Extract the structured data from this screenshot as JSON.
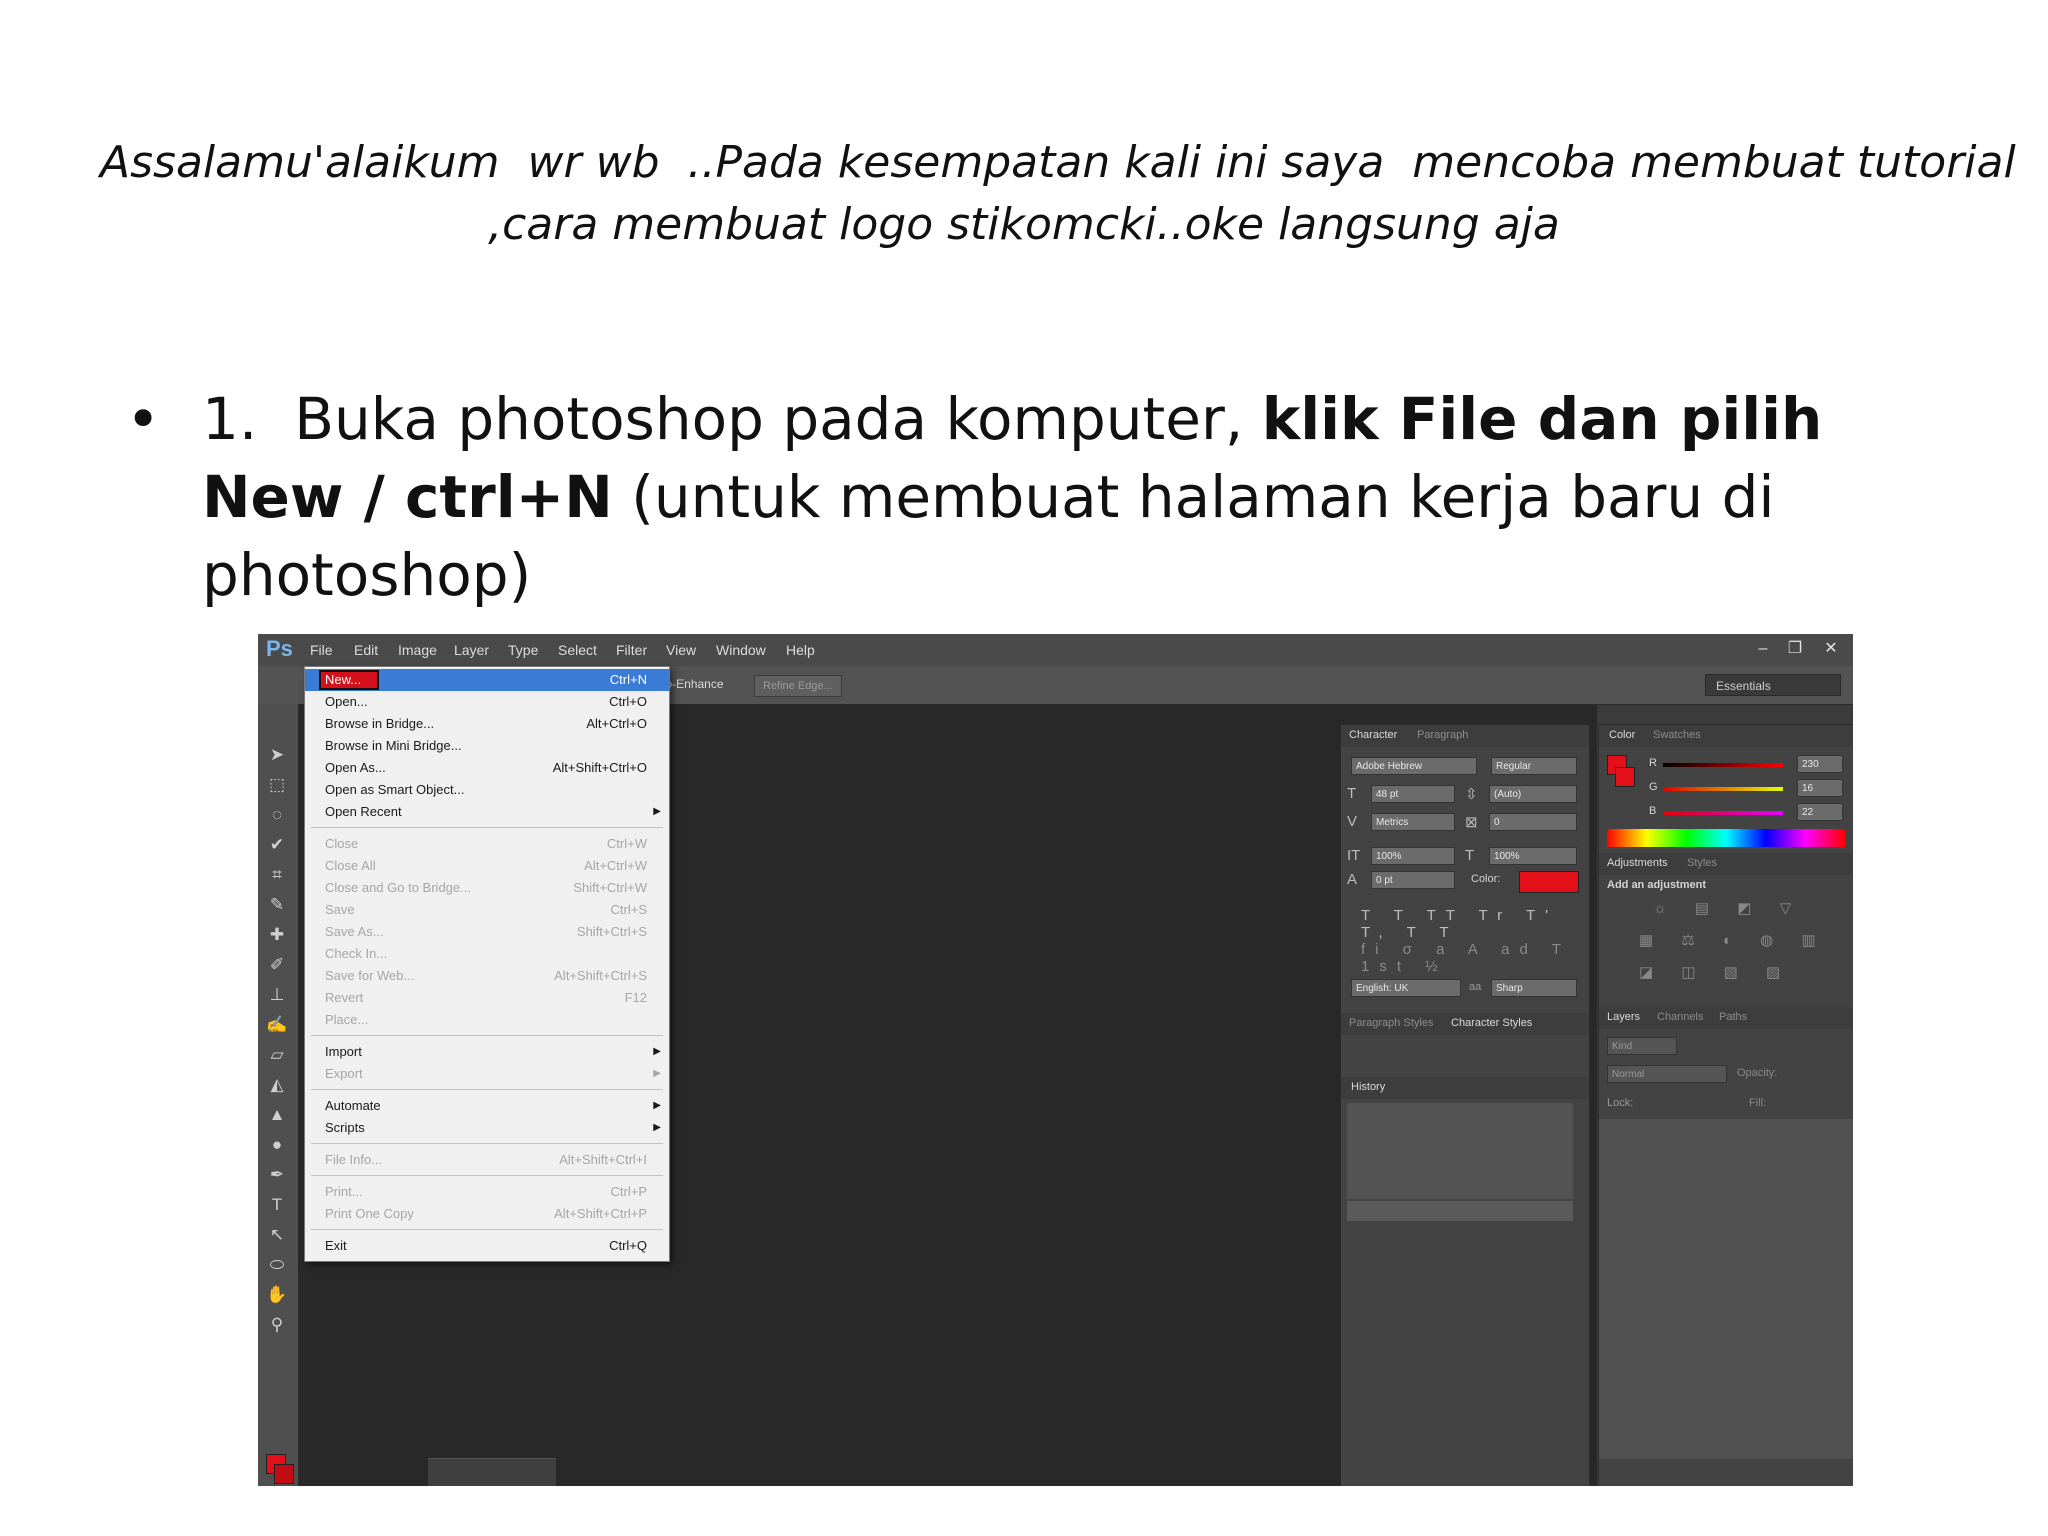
{
  "intro": {
    "line1": "Assalamu'alaikum  wr wb  ..Pada kesempatan kali ini saya  mencoba membuat tutorial",
    "line2": ",cara membuat logo stikomcki..oke langsung aja"
  },
  "step1": {
    "bullet": "•",
    "number": "1.",
    "text_plain_1": "Buka photoshop pada komputer, ",
    "text_bold_1": "klik File dan pilih New / ctrl+N",
    "text_plain_2": " (untuk membuat halaman kerja baru di photoshop)"
  },
  "screenshot": {
    "logo": "Ps",
    "menu": [
      "File",
      "Edit",
      "Image",
      "Layer",
      "Type",
      "Select",
      "Filter",
      "View",
      "Window",
      "Help"
    ],
    "window_buttons": [
      "–",
      "❐",
      "✕"
    ],
    "options": {
      "auto_enhance": "Auto-Enhance",
      "refine_edge": "Refine Edge...",
      "workspace": "Essentials"
    },
    "file_menu": [
      {
        "label": "New...",
        "shortcut": "Ctrl+N",
        "highlight": true
      },
      {
        "label": "Open...",
        "shortcut": "Ctrl+O"
      },
      {
        "label": "Browse in Bridge...",
        "shortcut": "Alt+Ctrl+O"
      },
      {
        "label": "Browse in Mini Bridge...",
        "shortcut": ""
      },
      {
        "label": "Open As...",
        "shortcut": "Alt+Shift+Ctrl+O"
      },
      {
        "label": "Open as Smart Object...",
        "shortcut": ""
      },
      {
        "label": "Open Recent",
        "shortcut": "",
        "submenu": true
      },
      {
        "label": "Close",
        "shortcut": "Ctrl+W",
        "disabled": true
      },
      {
        "label": "Close All",
        "shortcut": "Alt+Ctrl+W",
        "disabled": true
      },
      {
        "label": "Close and Go to Bridge...",
        "shortcut": "Shift+Ctrl+W",
        "disabled": true
      },
      {
        "label": "Save",
        "shortcut": "Ctrl+S",
        "disabled": true
      },
      {
        "label": "Save As...",
        "shortcut": "Shift+Ctrl+S",
        "disabled": true
      },
      {
        "label": "Check In...",
        "shortcut": "",
        "disabled": true
      },
      {
        "label": "Save for Web...",
        "shortcut": "Alt+Shift+Ctrl+S",
        "disabled": true
      },
      {
        "label": "Revert",
        "shortcut": "F12",
        "disabled": true
      },
      {
        "label": "Place...",
        "shortcut": "",
        "disabled": true
      },
      {
        "label": "Import",
        "shortcut": "",
        "submenu": true
      },
      {
        "label": "Export",
        "shortcut": "",
        "submenu": true,
        "disabled": true
      },
      {
        "label": "Automate",
        "shortcut": "",
        "submenu": true
      },
      {
        "label": "Scripts",
        "shortcut": "",
        "submenu": true
      },
      {
        "label": "File Info...",
        "shortcut": "Alt+Shift+Ctrl+I",
        "disabled": true
      },
      {
        "label": "Print...",
        "shortcut": "Ctrl+P",
        "disabled": true
      },
      {
        "label": "Print One Copy",
        "shortcut": "Alt+Shift+Ctrl+P",
        "disabled": true
      },
      {
        "label": "Exit",
        "shortcut": "Ctrl+Q"
      }
    ],
    "character_panel": {
      "tabs": [
        "Character",
        "Paragraph"
      ],
      "font": "Adobe Hebrew",
      "style": "Regular",
      "size": "48 pt",
      "leading": "(Auto)",
      "kerning": "Metrics",
      "tracking": "0",
      "vscale": "100%",
      "hscale": "100%",
      "baseline": "0 pt",
      "color_label": "Color:",
      "language": "English: UK",
      "aa": "Sharp",
      "text_color": "#e3101a"
    },
    "styles_tabs": [
      "Paragraph Styles",
      "Character Styles"
    ],
    "history_tab": "History",
    "color_panel": {
      "tabs": [
        "Color",
        "Swatches"
      ],
      "r_label": "R",
      "g_label": "G",
      "b_label": "B",
      "r": "230",
      "g": "16",
      "b": "22"
    },
    "adjustments_panel": {
      "tabs": [
        "Adjustments",
        "Styles"
      ],
      "heading": "Add an adjustment"
    },
    "layers_panel": {
      "tabs": [
        "Layers",
        "Channels",
        "Paths"
      ],
      "kind": "Kind",
      "blend": "Normal",
      "opacity_label": "Opacity:",
      "lock_label": "Lock:",
      "fill_label": "Fill:"
    }
  }
}
